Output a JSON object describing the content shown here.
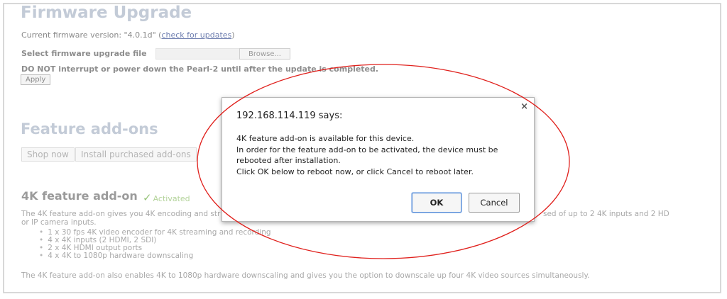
{
  "firmware": {
    "title": "Firmware Upgrade",
    "current_prefix": "Current firmware version: \"4.0.1d\" (",
    "check_link": "check for updates",
    "current_suffix": ")",
    "select_label": "Select firmware upgrade file",
    "browse_label": "Browse...",
    "warning": "DO NOT interrupt or power down the Pearl-2 until after the update is completed.",
    "apply_label": "Apply"
  },
  "addons": {
    "title": "Feature add-ons",
    "shop_label": "Shop now",
    "install_label": "Install purchased add-ons",
    "k4_title": "4K feature add-on",
    "activated_label": "Activated",
    "desc_line1_left": "The 4K feature add-on gives you 4K encoding and str",
    "desc_line1_right": "sed of up to 2 4K inputs and 2 HD",
    "desc_line2": "or IP camera inputs.",
    "bullets": [
      "1 x 30 fps 4K video encoder for 4K streaming and recording",
      "4 x 4K inputs (2 HDMI, 2 SDI)",
      "2 x 4K HDMI output ports",
      "4 x 4K to 1080p hardware downscaling"
    ],
    "footer": "The 4K feature add-on also enables 4K to 1080p hardware downscaling and gives you the option to downscale up four 4K video sources simultaneously."
  },
  "dialog": {
    "title": "192.168.114.119 says:",
    "line1": "4K feature add-on is available for this device.",
    "line2": "In order for the feature add-on to be activated, the device must be",
    "line3": "rebooted after installation.",
    "line4": "Click OK below to reboot now, or click Cancel to reboot later.",
    "close_glyph": "×",
    "ok_label": "OK",
    "cancel_label": "Cancel"
  },
  "colors": {
    "annotation_ellipse": "#e0201c",
    "heading": "#c3cbd7",
    "activated": "#97c47a",
    "ok_focus": "#5b8fd8"
  },
  "icons": {
    "activated": "check-icon",
    "close": "close-icon"
  }
}
